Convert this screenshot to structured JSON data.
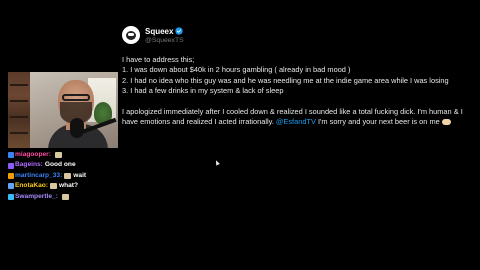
{
  "tweet": {
    "display_name": "Squeex",
    "handle": "@SqueexTS",
    "verified": true,
    "intro": "I have to address this;",
    "points": [
      "1. I was down about $40k in 2 hours gambling ( already in bad mood )",
      "2. I had no idea who this guy was and he was needling me at the indie game area while I was losing",
      "3. I had a few drinks in my system & lack of sleep"
    ],
    "apology_part1": "I apologized immediately after I cooled down & realized I sounded like a total fucking dick. I'm human & I have emotions and realized I acted irrationally. ",
    "mention": "@EsfandTV",
    "apology_part2": " I'm sorry and your next beer is on me"
  },
  "chat": {
    "messages": [
      {
        "user": "miagooper",
        "color": "#ff4aa2",
        "message": "",
        "badge_color": "#3b82f6",
        "emote": true
      },
      {
        "user": "Bageins",
        "color": "#b26cff",
        "message": "Good one",
        "badge_color": "#8b5cf6",
        "emote": false
      },
      {
        "user": "martincarp_33",
        "color": "#3b82f6",
        "message": "wait",
        "badge_color": "#f59e0b",
        "emote": true
      },
      {
        "user": "EnotaKao",
        "color": "#facc15",
        "message": "what?",
        "badge_color": "#60a5fa",
        "emote": true
      },
      {
        "user": "Swampertle_",
        "color": "#a78bfa",
        "message": "",
        "badge_color": "#38bdf8",
        "emote": true
      }
    ]
  },
  "colors": {
    "background": "#000000",
    "text": "#e7e9ea",
    "handle": "#71767b",
    "mention": "#1d9bf0",
    "verified": "#1d9bf0"
  },
  "icons": {
    "verified": "verified-badge-icon",
    "avatar": "profile-avatar",
    "emoji": "handshake-emoji-icon"
  }
}
